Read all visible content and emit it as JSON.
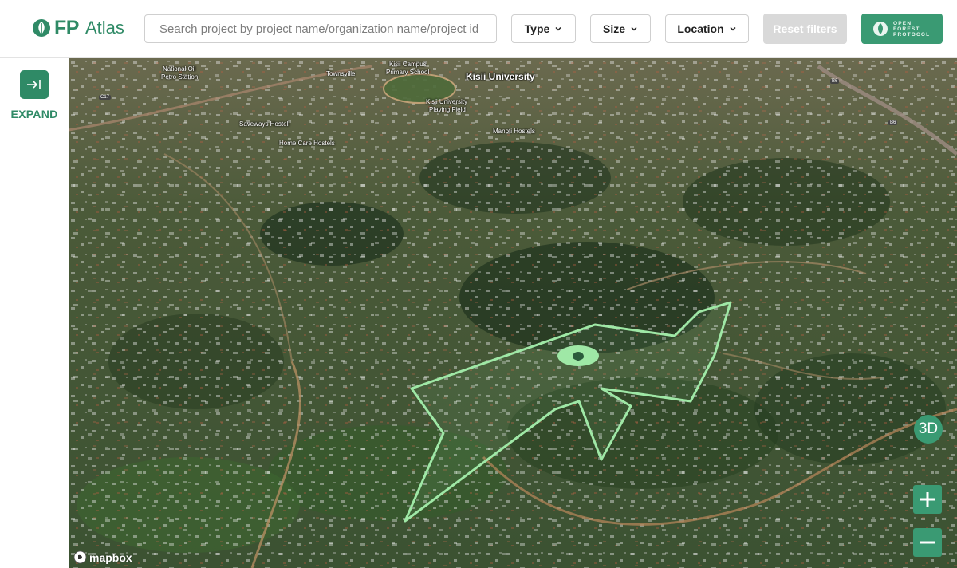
{
  "app": {
    "logo_mark": "FP",
    "logo_name": "Atlas",
    "brand_color": "#2f8a66"
  },
  "search": {
    "placeholder": "Search project by project name/organization name/project id"
  },
  "filters": {
    "type_label": "Type",
    "size_label": "Size",
    "location_label": "Location",
    "reset_label": "Reset filters"
  },
  "badge": {
    "line1": "OPEN",
    "line2": "FOREST",
    "line3": "PROTOCOL"
  },
  "sidebar": {
    "expand_label": "EXPAND",
    "expand_icon": "expand-right-icon"
  },
  "map": {
    "poi": {
      "national_oil": "National Oil",
      "petro_station": "Petro Station",
      "townsville": "Townsville",
      "kisii_campus": "Kisii Campus",
      "primary_school": "Primary School",
      "kisii_university": "Kisii University",
      "uni_field_1": "Kisii University",
      "uni_field_2": "Playing Field",
      "saveways": "Saveways Hostell",
      "manoti": "Manoti Hostels",
      "home_care": "Home Care Hostels",
      "road_c17": "C17",
      "road_b6_1": "B6",
      "road_b6_2": "B6"
    },
    "btn_3d": "3D",
    "zoom_in_icon": "plus-icon",
    "zoom_out_icon": "minus-icon",
    "attribution": "mapbox",
    "polygon_color": "#9fe8a6"
  }
}
